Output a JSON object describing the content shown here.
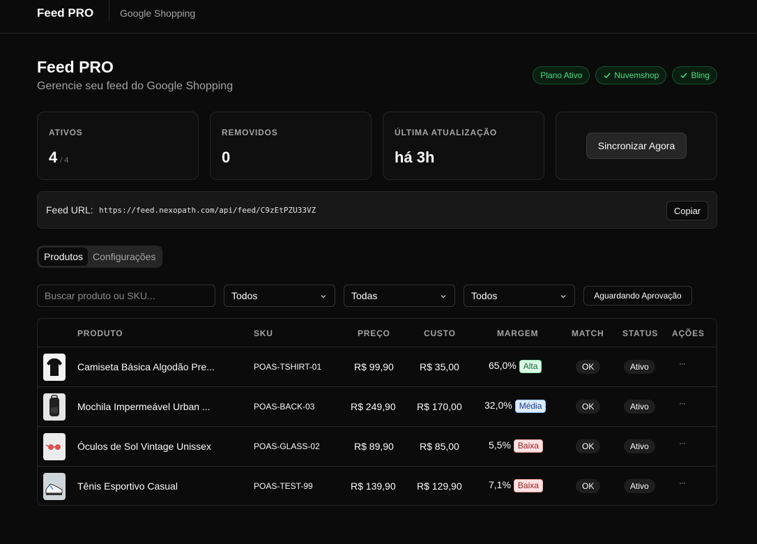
{
  "header": {
    "brand": "Feed PRO",
    "nav_item": "Google Shopping"
  },
  "page": {
    "title": "Feed PRO",
    "subtitle": "Gerencie seu feed do Google Shopping"
  },
  "badges": [
    {
      "label": "Plano Ativo",
      "icon": "none"
    },
    {
      "label": "Nuvemshop",
      "icon": "check-icon"
    },
    {
      "label": "Bling",
      "icon": "check-icon"
    }
  ],
  "stats": {
    "active_label": "ATIVOS",
    "active_value": "4",
    "active_total": "/ 4",
    "removed_label": "REMOVIDOS",
    "removed_value": "0",
    "updated_label": "ÚLTIMA ATUALIZAÇÃO",
    "updated_value": "há 3h",
    "sync_button": "Sincronizar Agora"
  },
  "feed": {
    "label": "Feed URL:",
    "url": "https://feed.nexopath.com/api/feed/C9zEtPZU33VZ",
    "copy_button": "Copiar"
  },
  "tabs": [
    {
      "label": "Produtos",
      "active": true
    },
    {
      "label": "Configurações",
      "active": false
    }
  ],
  "filters": {
    "search_placeholder": "Buscar produto ou SKU...",
    "select_1": "Todos",
    "select_2": "Todas",
    "select_3": "Todos",
    "await_button": "Aguardando Aprovação"
  },
  "table": {
    "headers": {
      "product": "PRODUTO",
      "sku": "SKU",
      "price": "PREÇO",
      "cost": "CUSTO",
      "margin": "MARGEM",
      "match": "MATCH",
      "status": "STATUS",
      "actions": "AÇÕES"
    },
    "rows": [
      {
        "product": "Camiseta Básica Algodão Pre...",
        "sku": "POAS-TSHIRT-01",
        "price": "R$ 99,90",
        "cost": "R$ 35,00",
        "margin": "65,0%",
        "margin_tag": "Alta",
        "match": "OK",
        "status": "Ativo",
        "actions": "···",
        "tag_color": "#16a34a"
      },
      {
        "product": "Mochila Impermeável Urban ...",
        "sku": "POAS-BACK-03",
        "price": "R$ 249,90",
        "cost": "R$ 170,00",
        "margin": "32,0%",
        "margin_tag": "Média",
        "match": "OK",
        "status": "Ativo",
        "actions": "···",
        "tag_color": "#2563eb"
      },
      {
        "product": "Óculos de Sol Vintage Unissex",
        "sku": "POAS-GLASS-02",
        "price": "R$ 89,90",
        "cost": "R$ 85,00",
        "margin": "5,5%",
        "margin_tag": "Baixa",
        "match": "OK",
        "status": "Ativo",
        "actions": "···",
        "tag_color": "#dc2626"
      },
      {
        "product": "Tênis Esportivo Casual",
        "sku": "POAS-TEST-99",
        "price": "R$ 139,90",
        "cost": "R$ 129,90",
        "margin": "7,1%",
        "margin_tag": "Baixa",
        "match": "OK",
        "status": "Ativo",
        "actions": "···",
        "tag_color": "#dc2626"
      }
    ]
  }
}
